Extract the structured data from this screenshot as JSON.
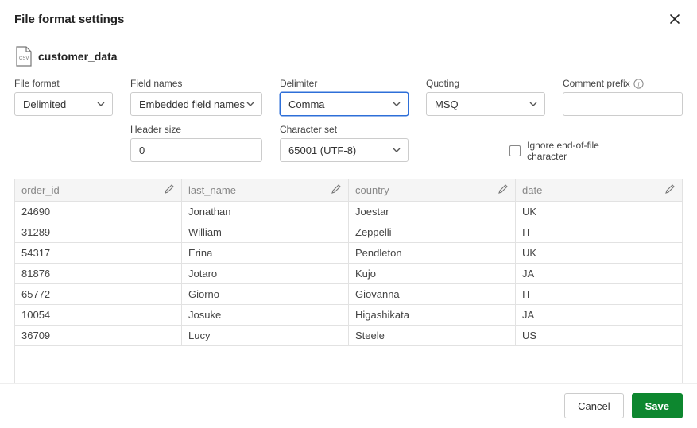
{
  "dialog": {
    "title": "File format settings"
  },
  "file": {
    "name": "customer_data",
    "icon_label": "CSV"
  },
  "form": {
    "file_format": {
      "label": "File format",
      "value": "Delimited"
    },
    "field_names": {
      "label": "Field names",
      "value": "Embedded field names"
    },
    "delimiter": {
      "label": "Delimiter",
      "value": "Comma"
    },
    "quoting": {
      "label": "Quoting",
      "value": "MSQ"
    },
    "comment_prefix": {
      "label": "Comment prefix",
      "value": ""
    },
    "header_size": {
      "label": "Header size",
      "value": "0"
    },
    "charset": {
      "label": "Character set",
      "value": "65001 (UTF-8)"
    },
    "ignore_eof": {
      "label": "Ignore end-of-file character",
      "checked": false
    }
  },
  "table": {
    "columns": [
      "order_id",
      "last_name",
      "country",
      "date"
    ],
    "rows": [
      [
        "24690",
        "Jonathan",
        "Joestar",
        "UK"
      ],
      [
        "31289",
        "William",
        "Zeppelli",
        "IT"
      ],
      [
        "54317",
        "Erina",
        "Pendleton",
        "UK"
      ],
      [
        "81876",
        "Jotaro",
        "Kujo",
        "JA"
      ],
      [
        "65772",
        "Giorno",
        "Giovanna",
        "IT"
      ],
      [
        "10054",
        "Josuke",
        "Higashikata",
        "JA"
      ],
      [
        "36709",
        "Lucy",
        "Steele",
        "US"
      ]
    ]
  },
  "footer": {
    "cancel": "Cancel",
    "save": "Save"
  }
}
